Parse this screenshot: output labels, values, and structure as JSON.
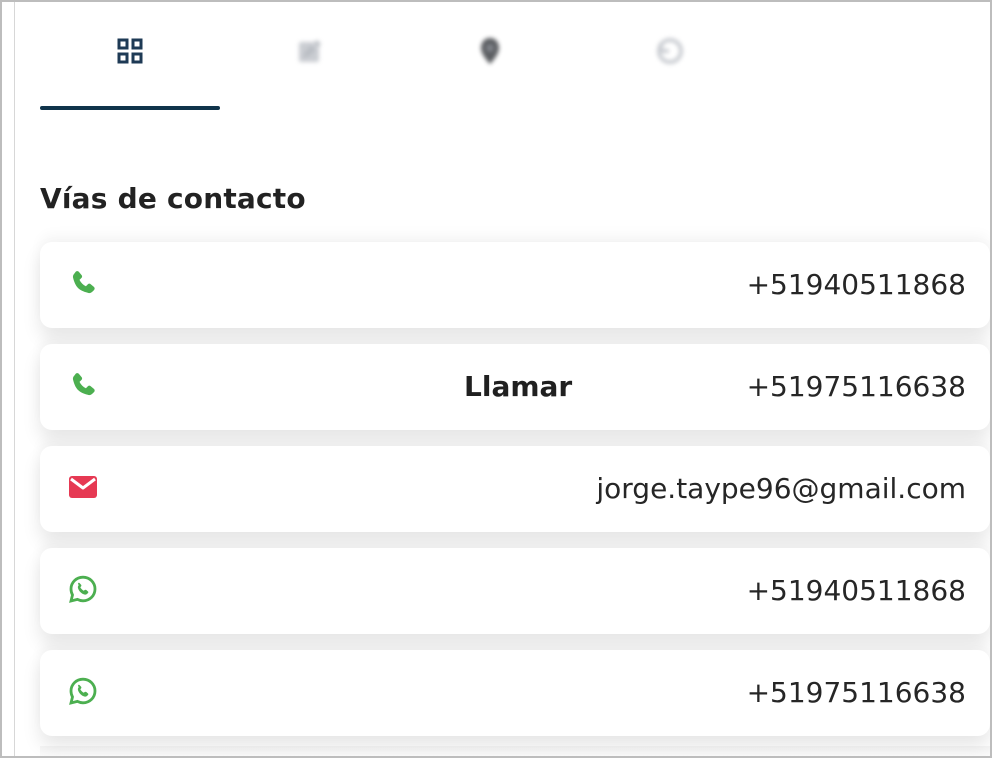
{
  "tabs": [
    {
      "name": "dashboard",
      "icon": "grid-icon",
      "active": true,
      "color": "#1e3a55"
    },
    {
      "name": "edit",
      "icon": "edit-icon",
      "active": false,
      "color": "#b8bcc3"
    },
    {
      "name": "location",
      "icon": "location-pin-icon",
      "active": false,
      "color": "#25282d"
    },
    {
      "name": "history",
      "icon": "history-icon",
      "active": false,
      "color": "#b8bcc3"
    }
  ],
  "section": {
    "title": "Vías de contacto"
  },
  "contacts": [
    {
      "type": "phone",
      "icon": "phone-icon",
      "action": "",
      "value": "+51940511868",
      "icon_color": "#4caf50"
    },
    {
      "type": "phone",
      "icon": "phone-icon",
      "action": "Llamar",
      "value": "+51975116638",
      "icon_color": "#4caf50"
    },
    {
      "type": "email",
      "icon": "mail-icon",
      "action": "",
      "value": "jorge.taype96@gmail.com",
      "icon_color": "#e63953"
    },
    {
      "type": "whatsapp",
      "icon": "whatsapp-icon",
      "action": "",
      "value": "+51940511868",
      "icon_color": "#4caf50"
    },
    {
      "type": "whatsapp",
      "icon": "whatsapp-icon",
      "action": "",
      "value": "+51975116638",
      "icon_color": "#4caf50"
    }
  ],
  "colors": {
    "active_tab_underline": "#10344b",
    "text": "#262626",
    "card_background": "#ffffff"
  }
}
